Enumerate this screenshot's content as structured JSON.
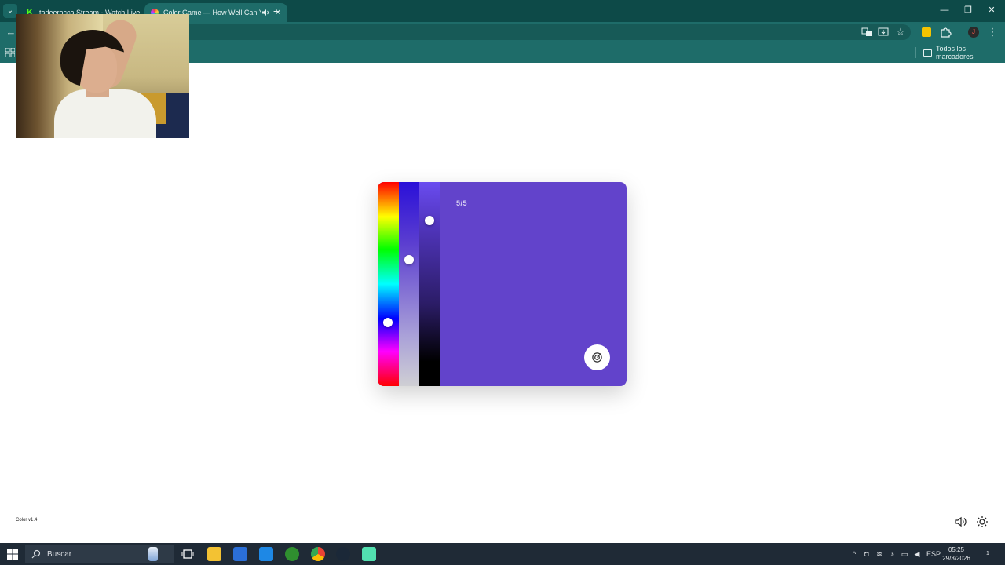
{
  "browser": {
    "tabs": [
      {
        "title": "tadeerocca Stream - Watch Live",
        "close": "✕"
      },
      {
        "title": "Color Game — How Well Can You See Color",
        "close": "✕",
        "active": true
      }
    ],
    "new_tab": "+",
    "window_controls": {
      "minimize": "—",
      "restore": "❐",
      "close": "✕"
    },
    "bookmarks": {
      "all_label": "Todos los marcadores"
    },
    "profile_initial": "J"
  },
  "game": {
    "counter": "5/5",
    "background_color": "#6243cb",
    "hue_level": 0.69,
    "saturation_level": 0.38,
    "lightness_level": 0.19
  },
  "footer": {
    "version": "Color v1.4"
  },
  "taskbar": {
    "search_placeholder": "Buscar",
    "language": "ESP",
    "time": "05:25",
    "date": "29/3/2026",
    "notification_count": "1"
  }
}
